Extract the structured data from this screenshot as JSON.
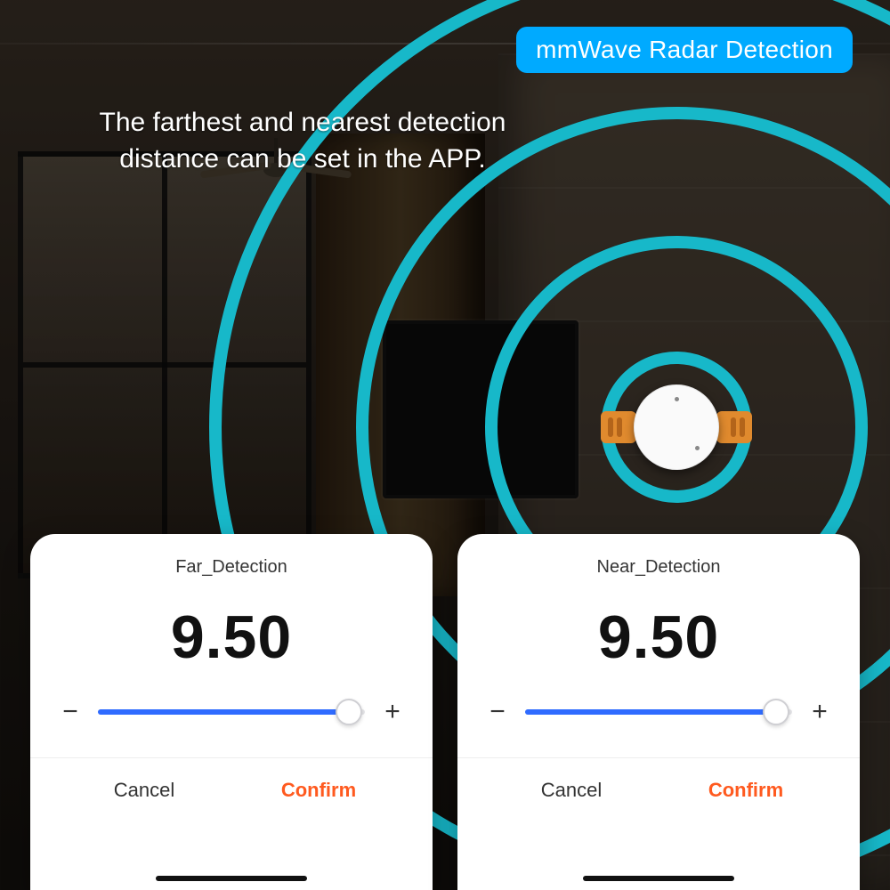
{
  "badge": {
    "label": "mmWave Radar Detection"
  },
  "subtitle": "The farthest and nearest detection distance can be set in the APP.",
  "cards": [
    {
      "title": "Far_Detection",
      "value": "9.50",
      "minus": "−",
      "plus": "+",
      "fill_percent": 94,
      "cancel": "Cancel",
      "confirm": "Confirm"
    },
    {
      "title": "Near_Detection",
      "value": "9.50",
      "minus": "−",
      "plus": "+",
      "fill_percent": 94,
      "cancel": "Cancel",
      "confirm": "Confirm"
    }
  ],
  "colors": {
    "badge_bg": "#00aaff",
    "ring": "#17b8c9",
    "slider_fill": "#2f6bff",
    "confirm": "#ff5a1f"
  }
}
